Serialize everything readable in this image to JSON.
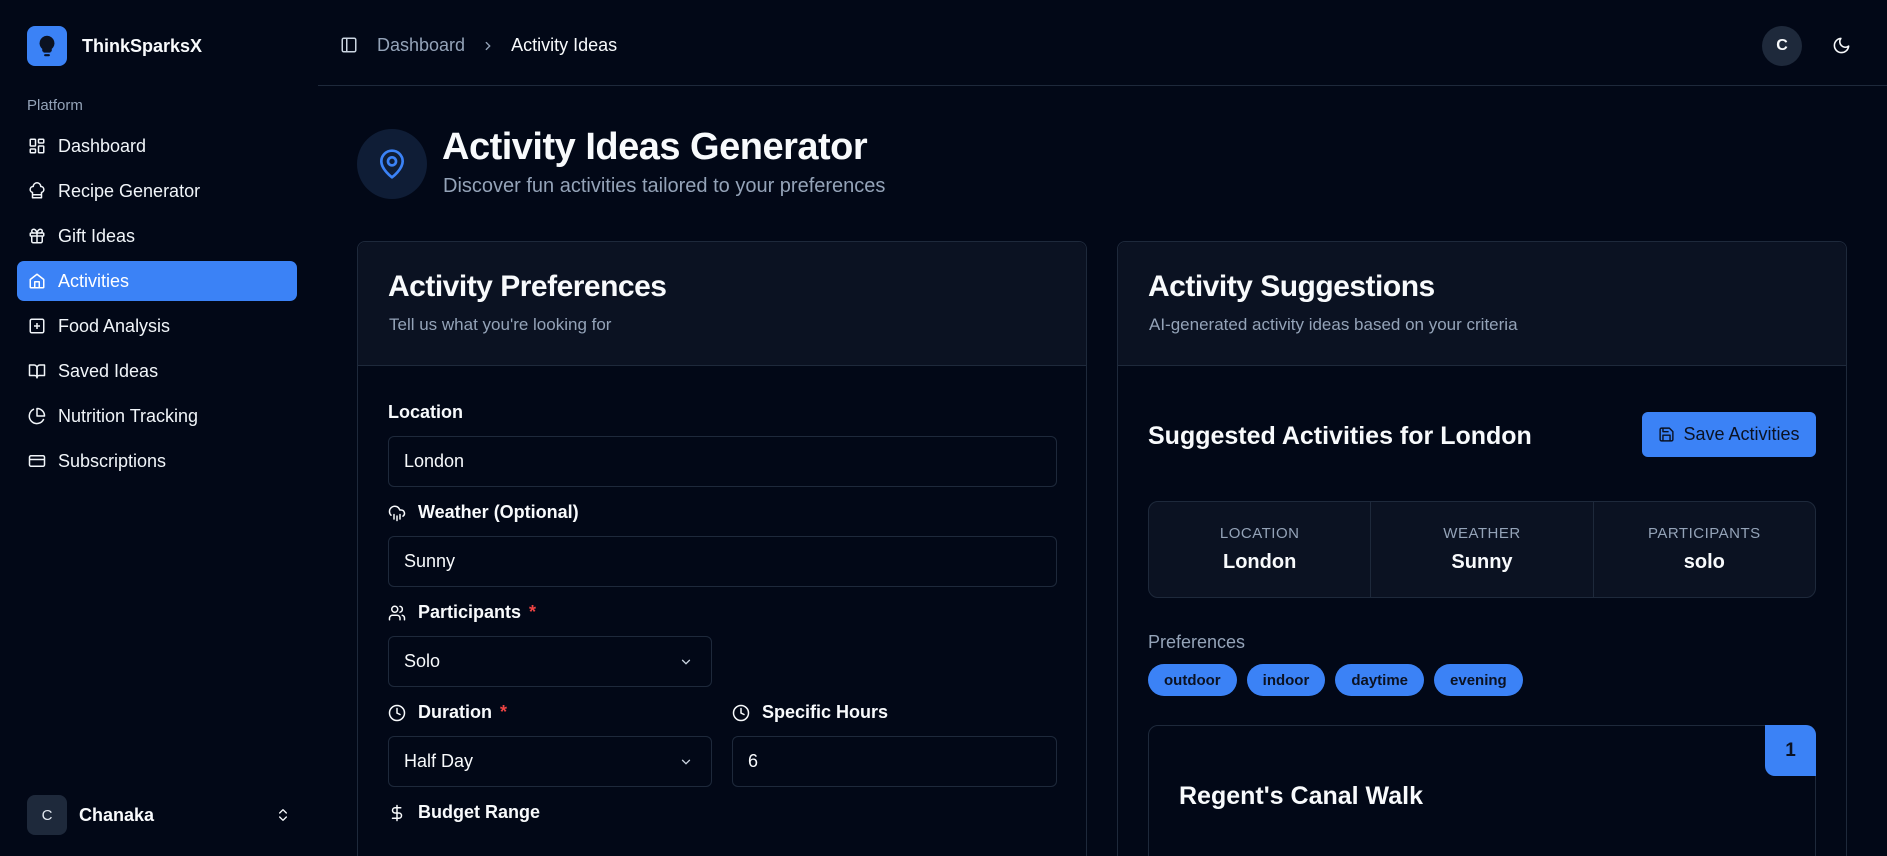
{
  "app": {
    "name": "ThinkSparksX"
  },
  "sidebar": {
    "section_label": "Platform",
    "items": [
      {
        "label": "Dashboard",
        "icon": "grid-icon",
        "active": false
      },
      {
        "label": "Recipe Generator",
        "icon": "chef-hat-icon",
        "active": false
      },
      {
        "label": "Gift Ideas",
        "icon": "gift-icon",
        "active": false
      },
      {
        "label": "Activities",
        "icon": "home-icon",
        "active": true
      },
      {
        "label": "Food Analysis",
        "icon": "plus-square-icon",
        "active": false
      },
      {
        "label": "Saved Ideas",
        "icon": "book-open-icon",
        "active": false
      },
      {
        "label": "Nutrition Tracking",
        "icon": "pie-chart-icon",
        "active": false
      },
      {
        "label": "Subscriptions",
        "icon": "credit-card-icon",
        "active": false
      }
    ],
    "user": {
      "initial": "C",
      "name": "Chanaka"
    }
  },
  "header": {
    "breadcrumb": {
      "parent": "Dashboard",
      "current": "Activity Ideas"
    },
    "avatar_initial": "C"
  },
  "page": {
    "title": "Activity Ideas Generator",
    "subtitle": "Discover fun activities tailored to your preferences"
  },
  "preferences": {
    "title": "Activity Preferences",
    "description": "Tell us what you're looking for",
    "location": {
      "label": "Location",
      "value": "London"
    },
    "weather": {
      "label": "Weather (Optional)",
      "value": "Sunny"
    },
    "participants": {
      "label": "Participants",
      "required_mark": "*",
      "value": "Solo"
    },
    "duration": {
      "label": "Duration",
      "required_mark": "*",
      "value": "Half Day"
    },
    "specific_hours": {
      "label": "Specific Hours",
      "value": "6"
    },
    "budget": {
      "label": "Budget Range"
    }
  },
  "suggestions": {
    "title": "Activity Suggestions",
    "description": "AI-generated activity ideas based on your criteria",
    "heading": "Suggested Activities for London",
    "save_label": "Save Activities",
    "summary": [
      {
        "key": "LOCATION",
        "value": "London"
      },
      {
        "key": "WEATHER",
        "value": "Sunny"
      },
      {
        "key": "PARTICIPANTS",
        "value": "solo"
      }
    ],
    "preferences_label": "Preferences",
    "tags": [
      "outdoor",
      "indoor",
      "daytime",
      "evening"
    ],
    "activities": [
      {
        "rank": "1",
        "title": "Regent's Canal Walk"
      }
    ]
  },
  "colors": {
    "background": "#020817",
    "accent": "#3b82f6",
    "muted_text": "#94a3b8",
    "border": "#1e293b",
    "required": "#ef4444"
  }
}
